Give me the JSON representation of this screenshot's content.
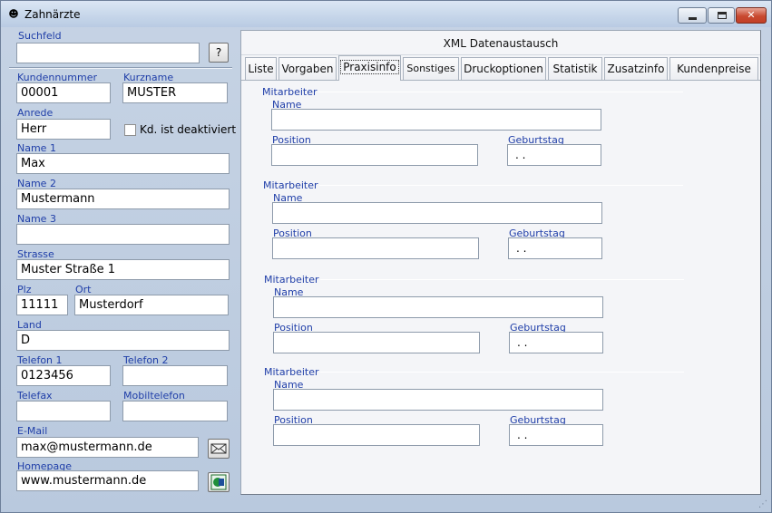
{
  "window": {
    "title": "Zahnärzte"
  },
  "search": {
    "label": "Suchfeld",
    "value": "",
    "button_label": "?"
  },
  "customer": {
    "number_label": "Kundennummer",
    "number": "00001",
    "shortname_label": "Kurzname",
    "shortname": "MUSTER",
    "salutation_label": "Anrede",
    "salutation": "Herr",
    "deactivated_label": "Kd. ist deaktiviert",
    "deactivated": false,
    "name1_label": "Name 1",
    "name1": "Max",
    "name2_label": "Name 2",
    "name2": "Mustermann",
    "name3_label": "Name 3",
    "name3": "",
    "street_label": "Strasse",
    "street": "Muster Straße 1",
    "zip_label": "Plz",
    "zip": "11111",
    "city_label": "Ort",
    "city": "Musterdorf",
    "country_label": "Land",
    "country": "D",
    "phone1_label": "Telefon 1",
    "phone1": "0123456",
    "phone2_label": "Telefon 2",
    "phone2": "",
    "fax_label": "Telefax",
    "fax": "",
    "mobile_label": "Mobiltelefon",
    "mobile": "",
    "email_label": "E-Mail",
    "email": "max@mustermann.de",
    "homepage_label": "Homepage",
    "homepage": "www.mustermann.de"
  },
  "panel": {
    "header": "XML Datenaustausch",
    "tabs": [
      {
        "label": "Liste"
      },
      {
        "label": "Vorgaben"
      },
      {
        "label": "Praxisinfo",
        "active": true
      },
      {
        "label": "Sonstiges"
      },
      {
        "label": "Druckoptionen"
      },
      {
        "label": "Statistik"
      },
      {
        "label": "Zusatzinfo"
      },
      {
        "label": "Kundenpreise"
      }
    ],
    "groups": [
      {
        "title": "Mitarbeiter",
        "name_label": "Name",
        "name": "",
        "position_label": "Position",
        "position": "",
        "birthday_label": "Geburtstag",
        "birthday": " .  ."
      },
      {
        "title": "Mitarbeiter",
        "name_label": "Name",
        "name": "",
        "position_label": "Position",
        "position": "",
        "birthday_label": "Geburtstag",
        "birthday": " .  ."
      },
      {
        "title": "Mitarbeiter",
        "name_label": "Name",
        "name": "",
        "position_label": "Position",
        "position": "",
        "birthday_label": "Geburtstag",
        "birthday": " .  ."
      },
      {
        "title": "Mitarbeiter",
        "name_label": "Name",
        "name": "",
        "position_label": "Position",
        "position": "",
        "birthday_label": "Geburtstag",
        "birthday": " .  ."
      }
    ]
  },
  "icons": {
    "app": "tooth-icon",
    "email_action": "mail-send-icon",
    "homepage_action": "web-browser-icon"
  }
}
